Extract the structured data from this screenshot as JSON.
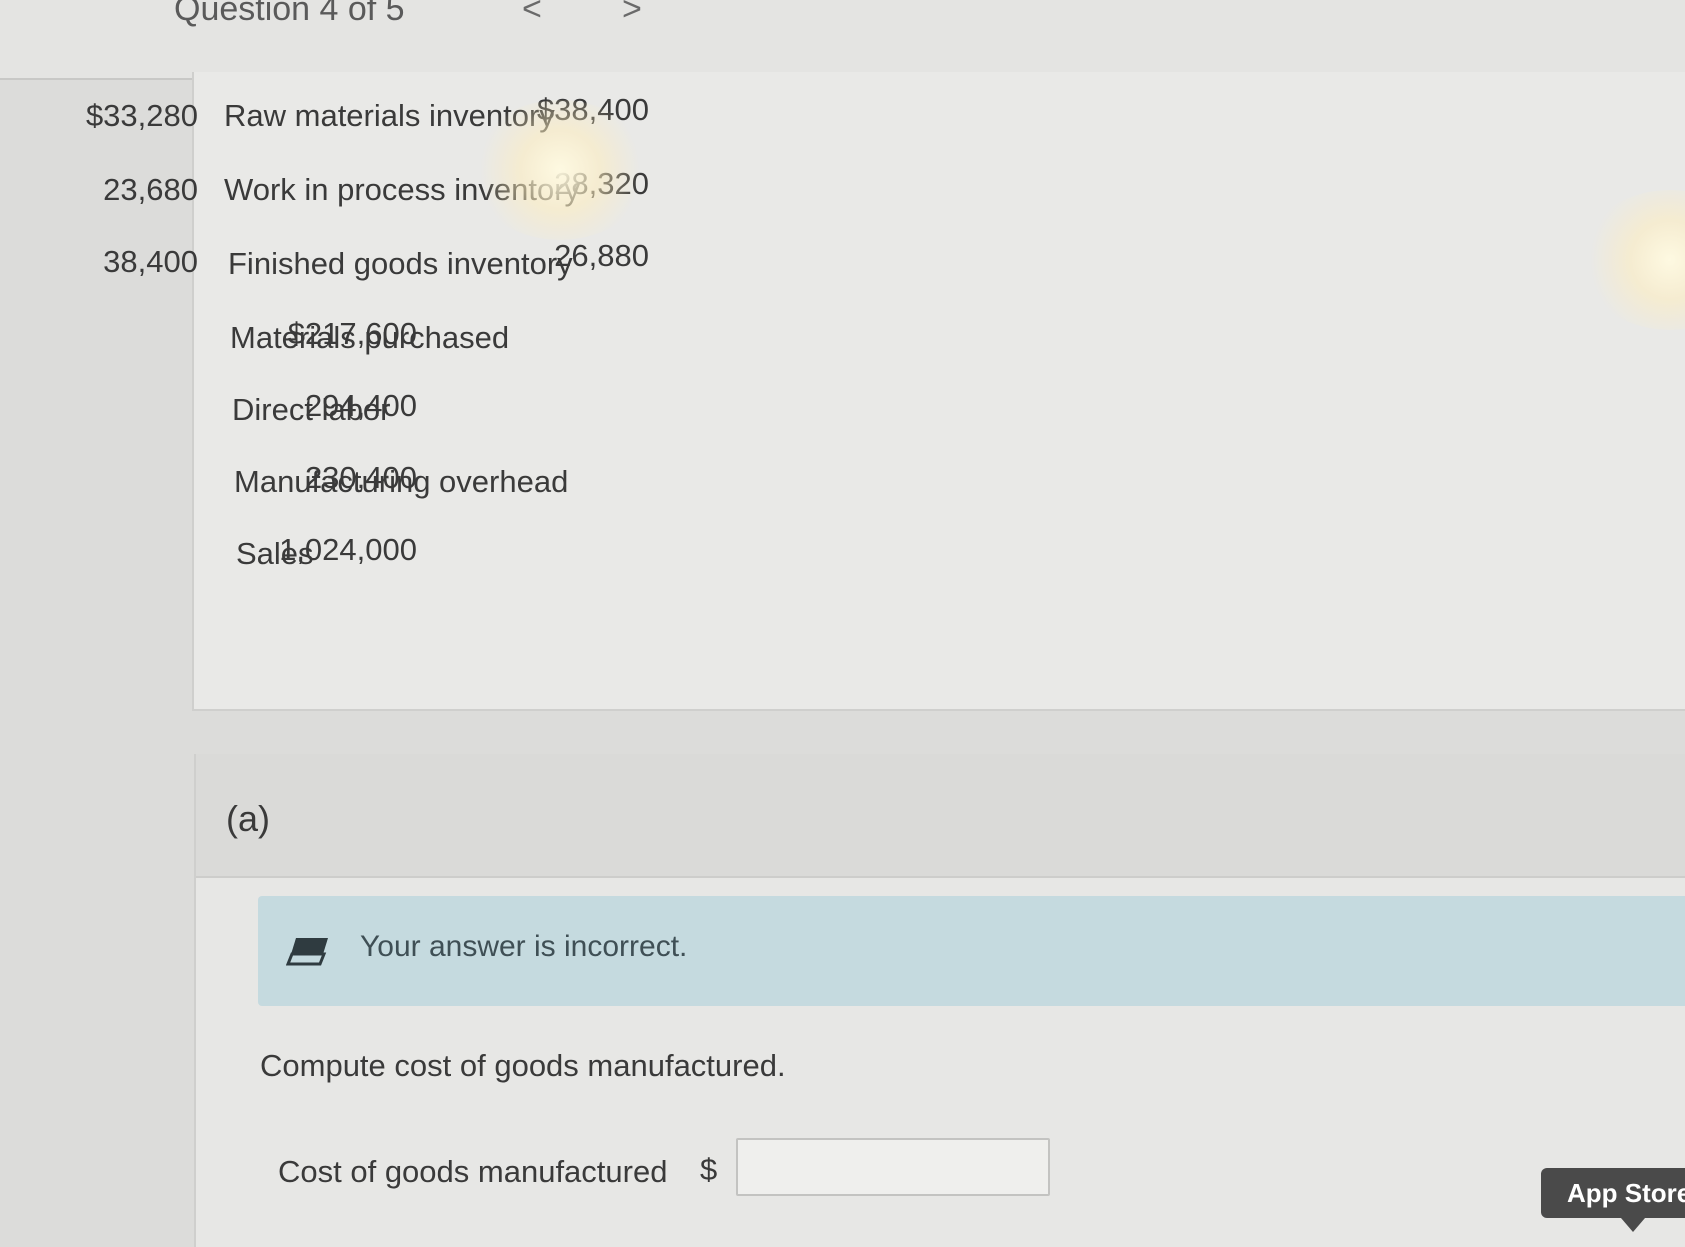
{
  "header": {
    "title": "Question 4 of 5",
    "prev_icon": "chevron-left-icon",
    "prev_glyph": "<",
    "next_icon": "chevron-right-icon",
    "next_glyph": ">"
  },
  "data_table": {
    "rows": [
      {
        "label": "Raw materials inventory",
        "col1": "$33,280",
        "col2": "",
        "col3": "$38,400"
      },
      {
        "label": "Work in process inventory",
        "col1": "23,680",
        "col2": "",
        "col3": "28,320"
      },
      {
        "label": "Finished goods inventory",
        "col1": "38,400",
        "col2": "",
        "col3": "26,880"
      },
      {
        "label": "Materials purchased",
        "col1": "",
        "col2": "$217,600",
        "col3": ""
      },
      {
        "label": "Direct labor",
        "col1": "",
        "col2": "294,400",
        "col3": ""
      },
      {
        "label": "Manufacturing overhead",
        "col1": "",
        "col2": "230,400",
        "col3": ""
      },
      {
        "label": "Sales",
        "col1": "",
        "col2": "1,024,000",
        "col3": ""
      }
    ]
  },
  "part_a": {
    "label": "(a)",
    "feedback": {
      "icon": "eraser-icon",
      "text": "Your answer is incorrect."
    },
    "prompt": "Compute cost of goods manufactured.",
    "answer": {
      "label": "Cost of goods manufactured",
      "currency": "$",
      "value": ""
    }
  },
  "overlay": {
    "app_store_label": "App Store"
  },
  "colors": {
    "background": "#dcdcda",
    "feedback_bg": "#c5dadf",
    "text": "#3a3a3a",
    "tooltip_bg": "#4a4a4a"
  }
}
